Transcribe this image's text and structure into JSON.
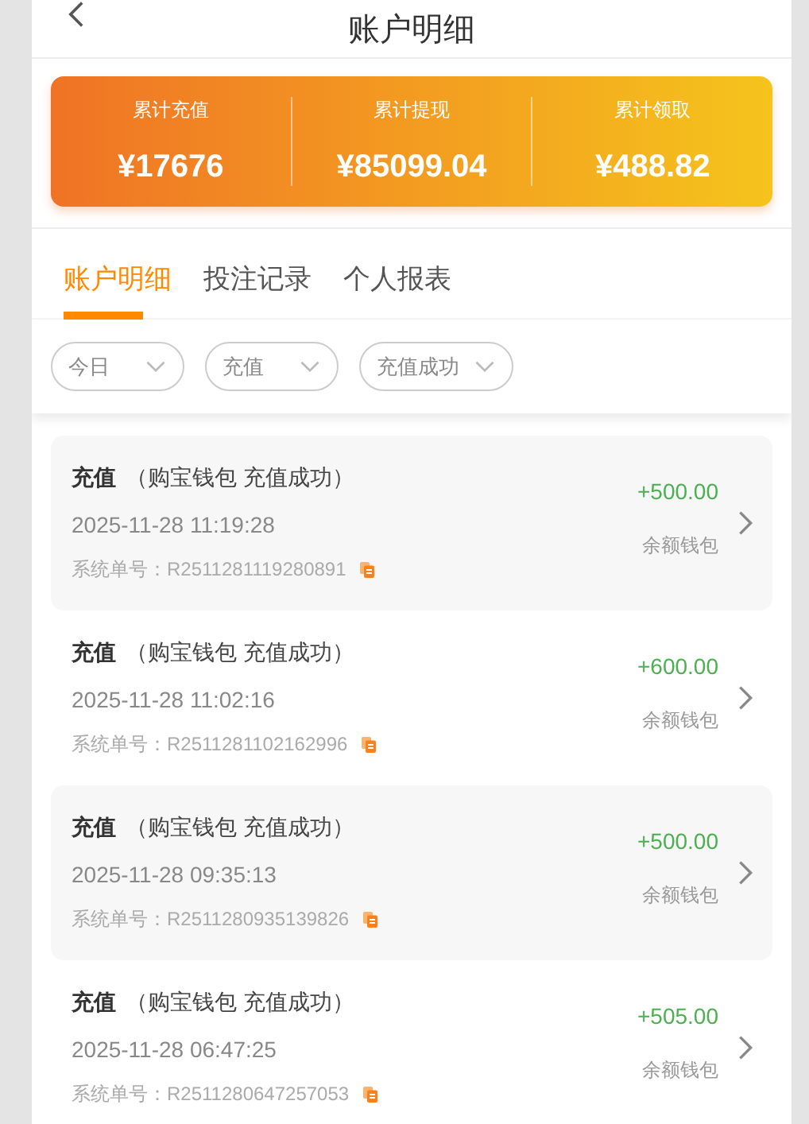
{
  "header": {
    "title": "账户明细"
  },
  "summary": [
    {
      "label": "累计充值",
      "value": "¥17676"
    },
    {
      "label": "累计提现",
      "value": "¥85099.04"
    },
    {
      "label": "累计领取",
      "value": "¥488.82"
    }
  ],
  "tabs": [
    {
      "label": "账户明细",
      "selected": true
    },
    {
      "label": "投注记录",
      "selected": false
    },
    {
      "label": "个人报表",
      "selected": false
    }
  ],
  "filters": [
    {
      "label": "今日"
    },
    {
      "label": "充值"
    },
    {
      "label": "充值成功"
    }
  ],
  "records": [
    {
      "type": "充值",
      "detail": "（购宝钱包 充值成功）",
      "time": "2025-11-28 11:19:28",
      "order_label": "系统单号：",
      "order_no": "R2511281119280891",
      "amount": "+500.00",
      "wallet": "余额钱包"
    },
    {
      "type": "充值",
      "detail": "（购宝钱包 充值成功）",
      "time": "2025-11-28 11:02:16",
      "order_label": "系统单号：",
      "order_no": "R2511281102162996",
      "amount": "+600.00",
      "wallet": "余额钱包"
    },
    {
      "type": "充值",
      "detail": "（购宝钱包 充值成功）",
      "time": "2025-11-28 09:35:13",
      "order_label": "系统单号：",
      "order_no": "R2511280935139826",
      "amount": "+500.00",
      "wallet": "余额钱包"
    },
    {
      "type": "充值",
      "detail": "（购宝钱包 充值成功）",
      "time": "2025-11-28 06:47:25",
      "order_label": "系统单号：",
      "order_no": "R2511280647257053",
      "amount": "+505.00",
      "wallet": "余额钱包"
    }
  ]
}
